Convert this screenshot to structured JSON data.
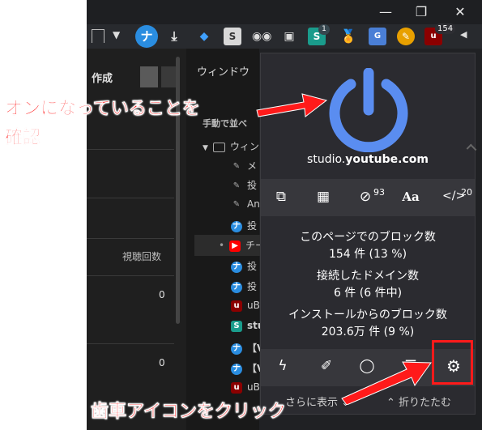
{
  "window": {
    "minimize": "—",
    "restore": "❐",
    "close": "✕"
  },
  "toolbar": {
    "ublock_badge": "154",
    "ext_badge": "1"
  },
  "left": {
    "create_label": "作成",
    "views_label": "視聴回数",
    "count1": "0",
    "count2": "0"
  },
  "middle": {
    "window_heading": "ウィンドウ",
    "sort_label": "手動で並べ",
    "rows": [
      "ウィン",
      "メ",
      "投",
      "An",
      "投",
      "チー",
      "投",
      "投",
      "uB",
      "stu",
      "【V",
      "【V",
      "uB"
    ]
  },
  "popup": {
    "domain_prefix": "studio.",
    "domain_main": "youtube.com",
    "icons": {
      "eye_count": "93",
      "font": "Aa",
      "code_count": "20"
    },
    "stats": {
      "page_block_label": "このページでのブロック数",
      "page_block_value": "154 件 (13 %)",
      "domains_label": "接続したドメイン数",
      "domains_value": "6 件 (6 件中)",
      "install_label": "インストールからのブロック数",
      "install_value": "203.6万 件 (9 %)"
    },
    "footer": {
      "more": "さらに表示",
      "fold": "折りたたむ"
    }
  },
  "annotations": {
    "top": "オンになっていることを",
    "top2": "確認",
    "bottom": "歯車アイコンをクリック"
  },
  "colors": {
    "accent_blue": "#5a8df0",
    "annotation_red": "#ff1a1a"
  }
}
